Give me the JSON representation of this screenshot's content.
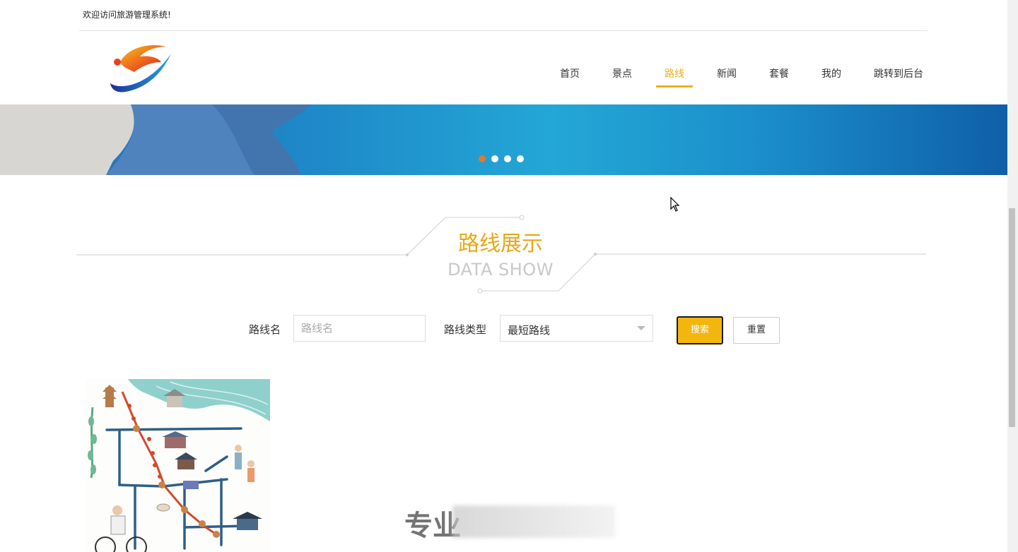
{
  "topbar": {
    "welcome": "欢迎访问旅游管理系统!"
  },
  "nav": {
    "items": [
      {
        "label": "首页",
        "active": false
      },
      {
        "label": "景点",
        "active": false
      },
      {
        "label": "路线",
        "active": true
      },
      {
        "label": "新闻",
        "active": false
      },
      {
        "label": "套餐",
        "active": false
      },
      {
        "label": "我的",
        "active": false
      },
      {
        "label": "跳转到后台",
        "active": false
      }
    ],
    "accent_color": "#e6b020"
  },
  "banner": {
    "slide_count": 4,
    "active_slide": 1,
    "active_dot_color": "#e07a32"
  },
  "section": {
    "title_cn": "路线展示",
    "title_en": "DATA SHOW"
  },
  "search": {
    "name_label": "路线名",
    "name_placeholder": "路线名",
    "name_value": "",
    "type_label": "路线类型",
    "type_selected": "最短路线",
    "search_button": "搜索",
    "reset_button": "重置"
  },
  "watermark": {
    "text": "专业"
  }
}
